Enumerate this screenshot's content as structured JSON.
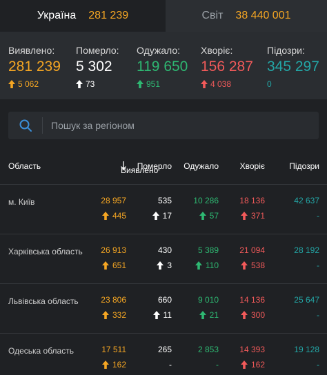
{
  "tabs": [
    {
      "label": "Україна",
      "value": "281 239"
    },
    {
      "label": "Світ",
      "value": "38 440 001"
    }
  ],
  "summary": [
    {
      "label": "Виявлено:",
      "value": "281 239",
      "delta": "5 062"
    },
    {
      "label": "Померло:",
      "value": "5 302",
      "delta": "73"
    },
    {
      "label": "Одужало:",
      "value": "119 650",
      "delta": "951"
    },
    {
      "label": "Хворіє:",
      "value": "156 287",
      "delta": "4 038"
    },
    {
      "label": "Підозри:",
      "value": "345 297",
      "delta": "0"
    }
  ],
  "search": {
    "placeholder": "Пошук за регіоном"
  },
  "table": {
    "headers": {
      "region": "Область",
      "confirmed": "Виявлено",
      "died": "Померло",
      "recovered": "Одужало",
      "sick": "Хворіє",
      "suspected": "Підозри"
    },
    "rows": [
      {
        "region": "м. Київ",
        "confirmed": "28 957",
        "confirmed_delta": "445",
        "died": "535",
        "died_delta": "17",
        "recovered": "10 286",
        "recovered_delta": "57",
        "sick": "18 136",
        "sick_delta": "371",
        "suspected": "42 637",
        "suspected_delta": "-"
      },
      {
        "region": "Харківська область",
        "confirmed": "26 913",
        "confirmed_delta": "651",
        "died": "430",
        "died_delta": "3",
        "recovered": "5 389",
        "recovered_delta": "110",
        "sick": "21 094",
        "sick_delta": "538",
        "suspected": "28 192",
        "suspected_delta": "-"
      },
      {
        "region": "Львівська область",
        "confirmed": "23 806",
        "confirmed_delta": "332",
        "died": "660",
        "died_delta": "11",
        "recovered": "9 010",
        "recovered_delta": "21",
        "sick": "14 136",
        "sick_delta": "300",
        "suspected": "25 647",
        "suspected_delta": "-"
      },
      {
        "region": "Одеська область",
        "confirmed": "17 511",
        "confirmed_delta": "162",
        "died": "265",
        "died_delta": "-",
        "recovered": "2 853",
        "recovered_delta": "-",
        "sick": "14 393",
        "sick_delta": "162",
        "suspected": "19 128",
        "suspected_delta": "-"
      }
    ]
  },
  "colors": {
    "confirmed": "#f5a623",
    "died": "#ffffff",
    "recovered": "#2eb872",
    "sick": "#f25a5a",
    "suspected": "#23a6a6"
  },
  "icons": {
    "search": "search-icon",
    "sort": "arrow-down-icon",
    "increase": "arrow-up-icon"
  }
}
